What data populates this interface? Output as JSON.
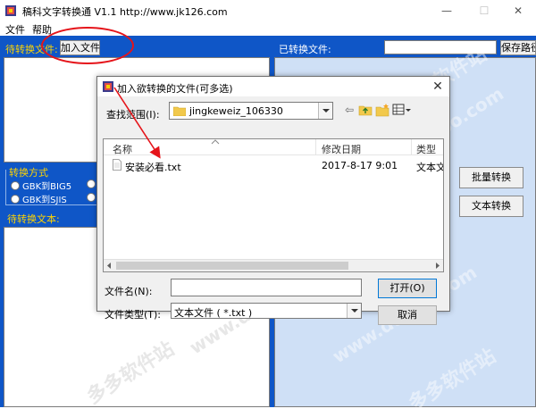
{
  "app": {
    "title": "稿科文字转换通 V1.1  http://www.jk126.com",
    "window_controls": {
      "minimize": "—",
      "maximize": "☐",
      "close": "✕"
    }
  },
  "menu": {
    "items": [
      "文件",
      "帮助"
    ]
  },
  "main": {
    "pending_files_label": "待转换文件:",
    "add_file_button": "加入文件",
    "converted_files_label": "已转换文件:",
    "save_path_button": "保存路径",
    "conversion_group_label": "转换方式",
    "options": [
      "GBK到BIG5",
      "GBK到SJIS"
    ],
    "pending_text_label": "待转换文本:",
    "batch_convert_button": "批量转换",
    "text_convert_button": "文本转换"
  },
  "watermarks": [
    "多多软件站",
    "www.ddooo.com"
  ],
  "dialog": {
    "title": "加入欲转换的文件(可多选)",
    "close": "✕",
    "look_in_label": "查找范围(I):",
    "look_in_value": "jingkeweiz_106330",
    "columns": [
      "名称",
      "修改日期",
      "类型"
    ],
    "rows": [
      {
        "name": "安装必看.txt",
        "date": "2017-8-17 9:01",
        "type": "文本文档"
      }
    ],
    "filename_label": "文件名(N):",
    "filename_value": "",
    "filetype_label": "文件类型(T):",
    "filetype_value": "文本文件 ( *.txt )",
    "open_button": "打开(O)",
    "cancel_button": "取消"
  },
  "colors": {
    "main_blue": "#0f56c7",
    "label_yellow": "#ffd400",
    "annotation_red": "#e5141a"
  }
}
